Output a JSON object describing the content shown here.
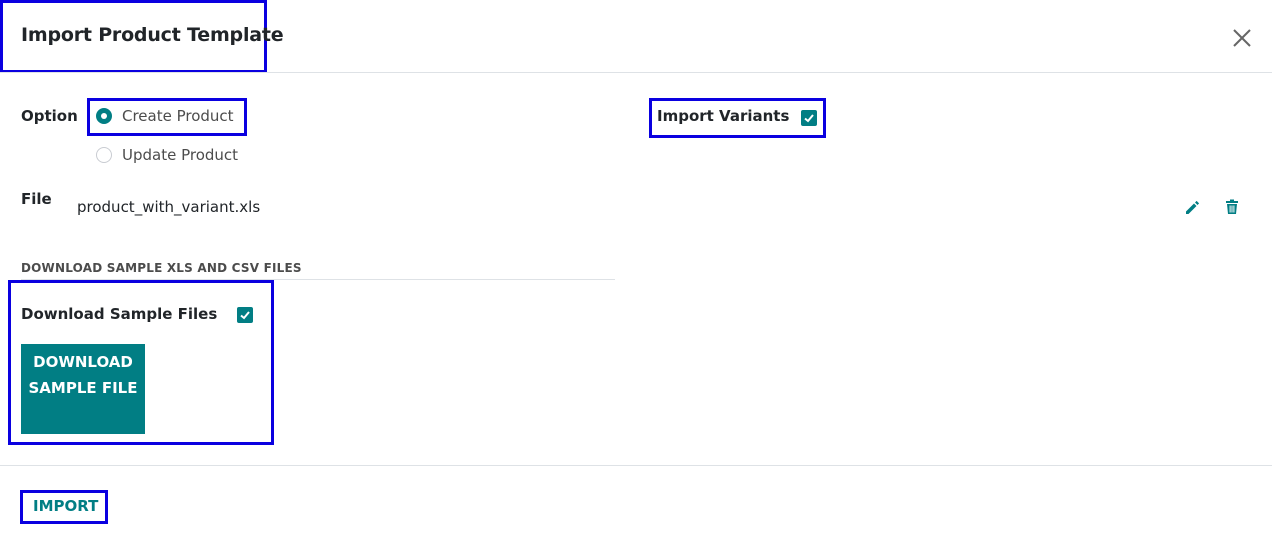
{
  "dialog": {
    "title": "Import Product Template"
  },
  "form": {
    "option_label": "Option",
    "options": [
      {
        "label": "Create Product",
        "selected": true
      },
      {
        "label": "Update Product",
        "selected": false
      }
    ],
    "import_variants_label": "Import Variants",
    "import_variants_checked": true,
    "file_label": "File",
    "file_name": "product_with_variant.xls"
  },
  "sample_section": {
    "title": "DOWNLOAD SAMPLE XLS AND CSV FILES",
    "download_sample_label": "Download Sample Files",
    "download_sample_checked": true,
    "download_button_label": "DOWNLOAD SAMPLE FILE"
  },
  "footer": {
    "import_label": "IMPORT"
  },
  "icons": {
    "close": "close-icon",
    "edit": "pencil-icon",
    "delete": "trash-icon",
    "check": "check-icon"
  },
  "colors": {
    "accent": "#017e84",
    "highlight": "#0a00e0",
    "text": "#212529",
    "muted": "#4c4c4c"
  }
}
